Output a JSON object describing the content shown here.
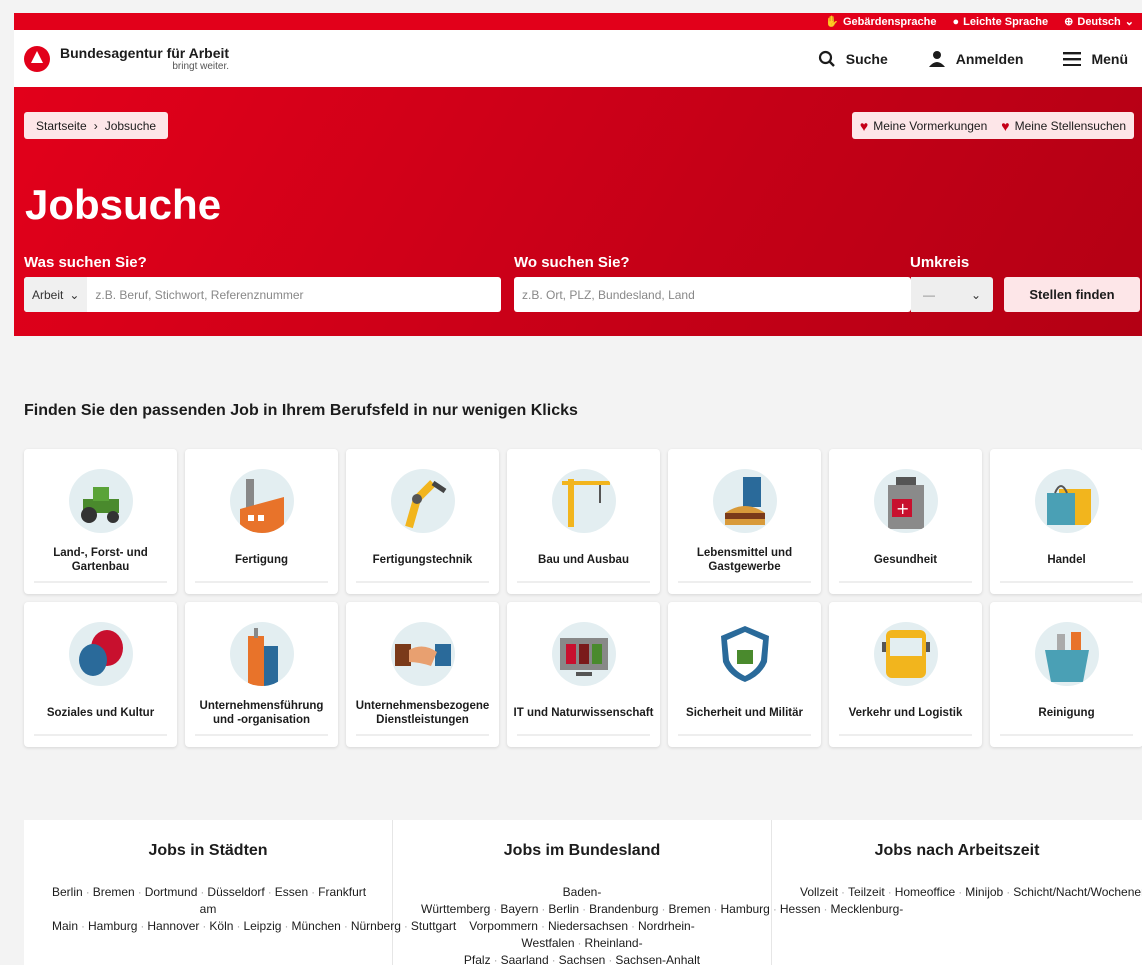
{
  "utility": {
    "sign_language": "Gebärdensprache",
    "easy_language": "Leichte Sprache",
    "language": "Deutsch"
  },
  "brand": {
    "name": "Bundesagentur für Arbeit",
    "tagline": "bringt weiter."
  },
  "nav": {
    "search": "Suche",
    "login": "Anmelden",
    "menu": "Menü"
  },
  "breadcrumb": {
    "home": "Startseite",
    "separator": "›",
    "current": "Jobsuche"
  },
  "saved": {
    "bookmarks": "Meine Vormerkungen",
    "searches": "Meine Stellensuchen"
  },
  "hero": {
    "title": "Jobsuche"
  },
  "search": {
    "what_label": "Was suchen Sie?",
    "type_value": "Arbeit",
    "what_placeholder": "z.B. Beruf, Stichwort, Referenznummer",
    "where_label": "Wo suchen Sie?",
    "where_placeholder": "z.B. Ort, PLZ, Bundesland, Land",
    "radius_label": "Umkreis",
    "radius_value": "—",
    "submit": "Stellen finden"
  },
  "fields": {
    "title": "Finden Sie den passenden Job in Ihrem Berufsfeld in nur wenigen Klicks",
    "items": [
      {
        "label": "Land-, Forst- und Gartenbau",
        "icon": "tractor-icon"
      },
      {
        "label": "Fertigung",
        "icon": "factory-icon"
      },
      {
        "label": "Fertigungstechnik",
        "icon": "robot-arm-icon"
      },
      {
        "label": "Bau und Ausbau",
        "icon": "crane-icon"
      },
      {
        "label": "Lebensmittel und Gastgewerbe",
        "icon": "food-icon"
      },
      {
        "label": "Gesundheit",
        "icon": "medicine-icon"
      },
      {
        "label": "Handel",
        "icon": "shopping-bag-icon"
      },
      {
        "label": "Soziales und Kultur",
        "icon": "theater-masks-icon"
      },
      {
        "label": "Unternehmensführung und -organisation",
        "icon": "office-tower-icon"
      },
      {
        "label": "Unternehmensbezogene Dienstleistungen",
        "icon": "handshake-icon"
      },
      {
        "label": "IT und Naturwissenschaft",
        "icon": "monitor-icon"
      },
      {
        "label": "Sicherheit und Militär",
        "icon": "shield-lock-icon"
      },
      {
        "label": "Verkehr und Logistik",
        "icon": "bus-icon"
      },
      {
        "label": "Reinigung",
        "icon": "cleaning-bucket-icon"
      }
    ]
  },
  "cities": {
    "title": "Jobs in Städten",
    "items": [
      "Berlin",
      "Bremen",
      "Dortmund",
      "Düsseldorf",
      "Essen",
      "Frankfurt am Main",
      "Hamburg",
      "Hannover",
      "Köln",
      "Leipzig",
      "München",
      "Nürnberg",
      "Stuttgart"
    ]
  },
  "states": {
    "title": "Jobs im Bundesland",
    "items": [
      "Baden-Württemberg",
      "Bayern",
      "Berlin",
      "Brandenburg",
      "Bremen",
      "Hamburg",
      "Hessen",
      "Mecklenburg-Vorpommern",
      "Niedersachsen",
      "Nordrhein-Westfalen",
      "Rheinland-Pfalz",
      "Saarland",
      "Sachsen",
      "Sachsen-Anhalt"
    ]
  },
  "worktime": {
    "title": "Jobs nach Arbeitszeit",
    "items": [
      "Vollzeit",
      "Teilzeit",
      "Homeoffice",
      "Minijob",
      "Schicht/Nacht/Wochenende"
    ]
  }
}
